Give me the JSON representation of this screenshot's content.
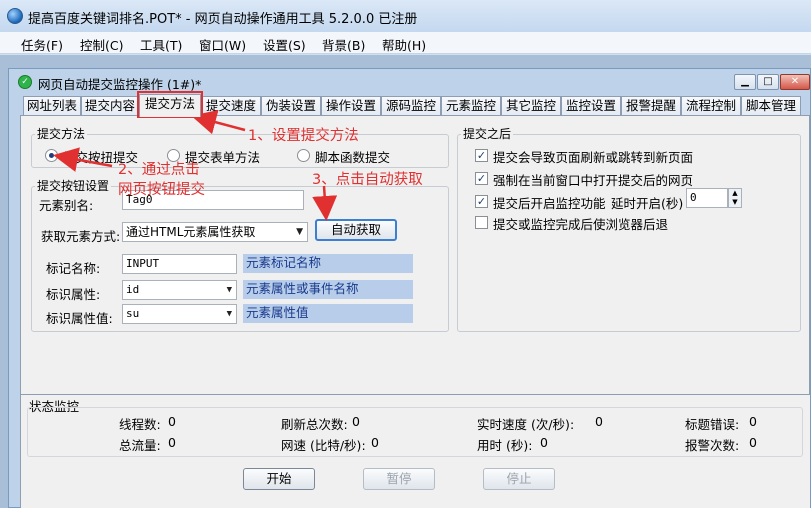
{
  "app": {
    "title": "提高百度关键词排名.POT* - 网页自动操作通用工具 5.2.0.0  已注册"
  },
  "menu": [
    "任务(F)",
    "控制(C)",
    "工具(T)",
    "窗口(W)",
    "设置(S)",
    "背景(B)",
    "帮助(H)"
  ],
  "child_window": {
    "title": "网页自动提交监控操作  (1#)*",
    "buttons": {
      "minimize": "▁",
      "maximize": "□",
      "close": "✕"
    }
  },
  "tabs": [
    "网址列表",
    "提交内容",
    "提交方法",
    "提交速度",
    "伪装设置",
    "操作设置",
    "源码监控",
    "元素监控",
    "其它监控",
    "监控设置",
    "报警提醒",
    "流程控制",
    "脚本管理"
  ],
  "submit_method": {
    "group_title": "提交方法",
    "options": [
      "提交按扭提交",
      "提交表单方法",
      "脚本函数提交"
    ],
    "selected": 0
  },
  "button_settings": {
    "group_title": "提交按钮设置",
    "alias_label": "元素别名:",
    "alias_value": "Tag0",
    "get_method_label": "获取元素方式:",
    "get_method_value": "通过HTML元素属性获取",
    "auto_button": "自动获取",
    "tag_label": "标记名称:",
    "tag_value": "INPUT",
    "tag_hint": "元素标记名称",
    "attr_label": "标识属性:",
    "attr_value": "id",
    "attr_hint": "元素属性或事件名称",
    "attrval_label": "标识属性值:",
    "attrval_value": "su",
    "attrval_hint": "元素属性值"
  },
  "after_submit": {
    "group_title": "提交之后",
    "options": [
      {
        "label": "提交会导致页面刷新或跳转到新页面",
        "checked": true
      },
      {
        "label": "强制在当前窗口中打开提交后的网页",
        "checked": true
      },
      {
        "label": "提交后开启监控功能",
        "checked": true
      },
      {
        "label": "提交或监控完成后使浏览器后退",
        "checked": false
      }
    ],
    "delay_label": "延时开启(秒)",
    "delay_value": "0"
  },
  "status": {
    "title": "状态监控",
    "items": [
      {
        "label": "线程数:",
        "value": "0"
      },
      {
        "label": "刷新总次数:",
        "value": "0"
      },
      {
        "label": "实时速度 (次/秒):",
        "value": "0"
      },
      {
        "label": "标题错误:",
        "value": "0"
      },
      {
        "label": "总流量:",
        "value": "0"
      },
      {
        "label": "网速 (比特/秒):",
        "value": "0"
      },
      {
        "label": "用时 (秒):",
        "value": "0"
      },
      {
        "label": "报警次数:",
        "value": "0"
      }
    ]
  },
  "controls": {
    "start": "开始",
    "pause": "暂停",
    "stop": "停止"
  },
  "annotations": {
    "step1": "1、设置提交方法",
    "step2_line1": "2、通过点击",
    "step2_line2": "网页按钮提交",
    "step3": "3、点击自动获取"
  },
  "colors": {
    "annotation": "#e03030",
    "hint_bg": "#b7cdea"
  }
}
